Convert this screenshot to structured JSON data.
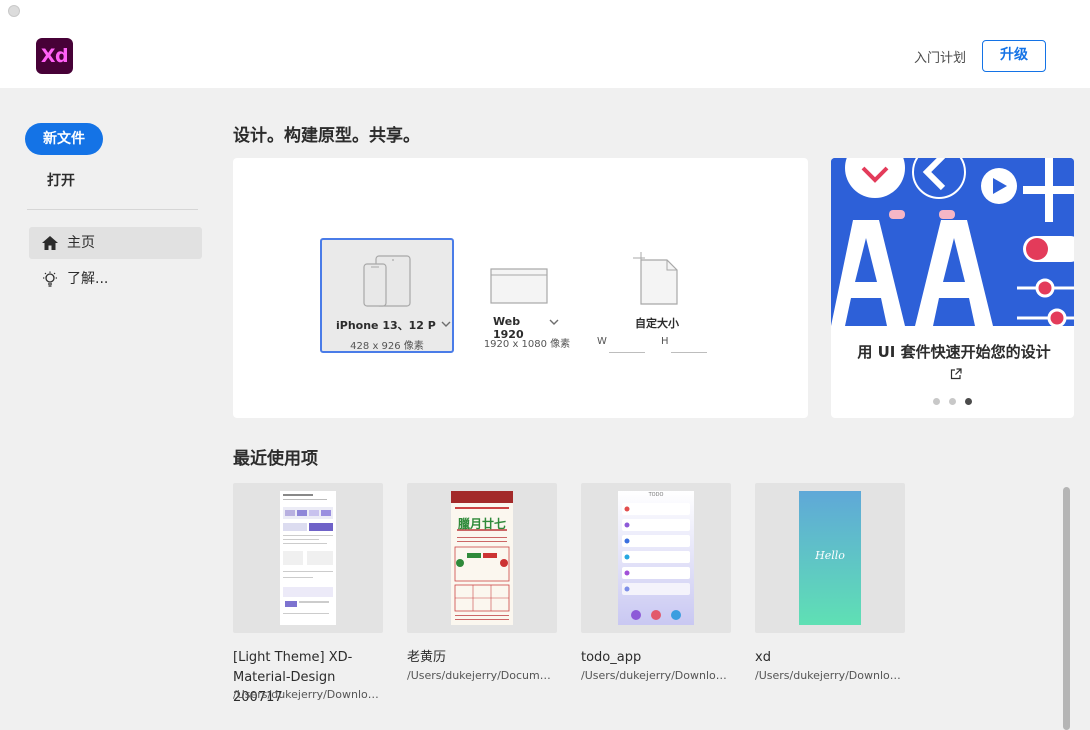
{
  "app": {
    "logo_text": "Xd",
    "plan_link": "入门计划",
    "upgrade_label": "升级"
  },
  "sidebar": {
    "new_label": "新文件",
    "open_label": "打开",
    "items": [
      {
        "label": "主页",
        "icon": "home-icon",
        "active": true
      },
      {
        "label": "了解...",
        "icon": "lightbulb-icon",
        "active": false
      }
    ]
  },
  "main": {
    "headline": "设计。构建原型。共享。",
    "presets": [
      {
        "name": "iPhone 13、12 Pr...",
        "size": "428 x 926 像素",
        "icon": "phone-tablet-icon",
        "selected": true
      },
      {
        "name": "Web 1920",
        "size": "1920 x 1080 像素",
        "icon": "browser-window-icon",
        "selected": false
      },
      {
        "name": "自定大小",
        "width_label": "W",
        "height_label": "H",
        "icon": "document-icon",
        "selected": false
      }
    ],
    "promo": {
      "text": "用 UI 套件快速开始您的设计",
      "slides": 3,
      "active_slide": 3
    },
    "recent_title": "最近使用项",
    "recent": [
      {
        "name": "[Light Theme] XD-Material-Design 200717",
        "path": "/Users/dukejerry/Download..."
      },
      {
        "name": "老黄历",
        "path": "/Users/dukejerry/Documents",
        "thumb_title": "臘月廿七"
      },
      {
        "name": "todo_app",
        "path": "/Users/dukejerry/Downloads",
        "thumb_title": "TODO"
      },
      {
        "name": "xd",
        "path": "/Users/dukejerry/Download...",
        "thumb_title": "Hello"
      }
    ]
  },
  "colors": {
    "accent": "#1473e6",
    "logo_bg": "#470137",
    "logo_fg": "#ff61f6",
    "promo_bg": "#2d60d8"
  }
}
